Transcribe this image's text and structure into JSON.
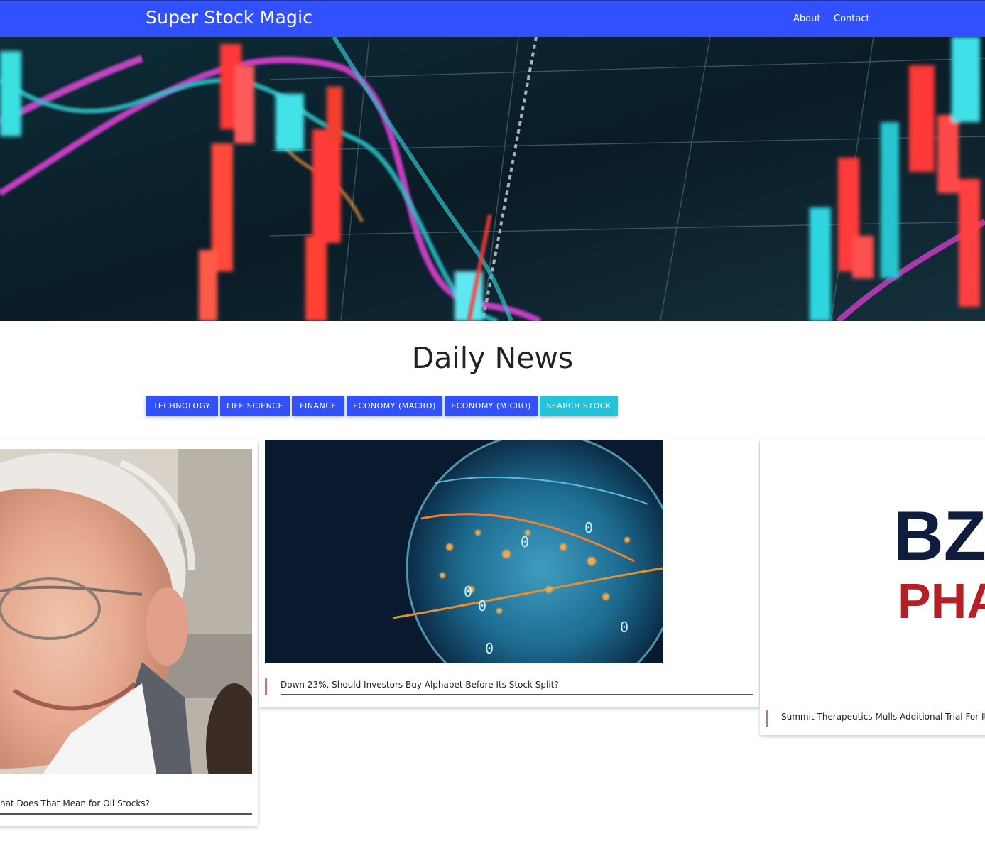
{
  "header": {
    "brand": "Super Stock Magic",
    "nav": {
      "about": "About",
      "contact": "Contact"
    },
    "color": "#3150ff"
  },
  "hero": {
    "image": "stock-chart-background"
  },
  "main": {
    "title": "Daily News",
    "categories": [
      {
        "label": "TECHNOLOGY"
      },
      {
        "label": "LIFE SCIENCE"
      },
      {
        "label": "FINANCE"
      },
      {
        "label": "ECONOMY (MACRO)"
      },
      {
        "label": "ECONOMY (MICRO)"
      },
      {
        "label": "SEARCH STOCK"
      }
    ],
    "accent_color": "#22c4dc",
    "articles": [
      {
        "title": "hat Does That Mean for Oil Stocks?",
        "image": "portrait-photo"
      },
      {
        "title": "Down 23%, Should Investors Buy Alphabet Before Its Stock Split?",
        "image": "digital-globe"
      },
      {
        "title": "Summit Therapeutics Mulls Additional Trial For Its Or",
        "image": "bz-pharma-logo",
        "logo_text": [
          "BZ",
          "PHA"
        ]
      }
    ]
  }
}
